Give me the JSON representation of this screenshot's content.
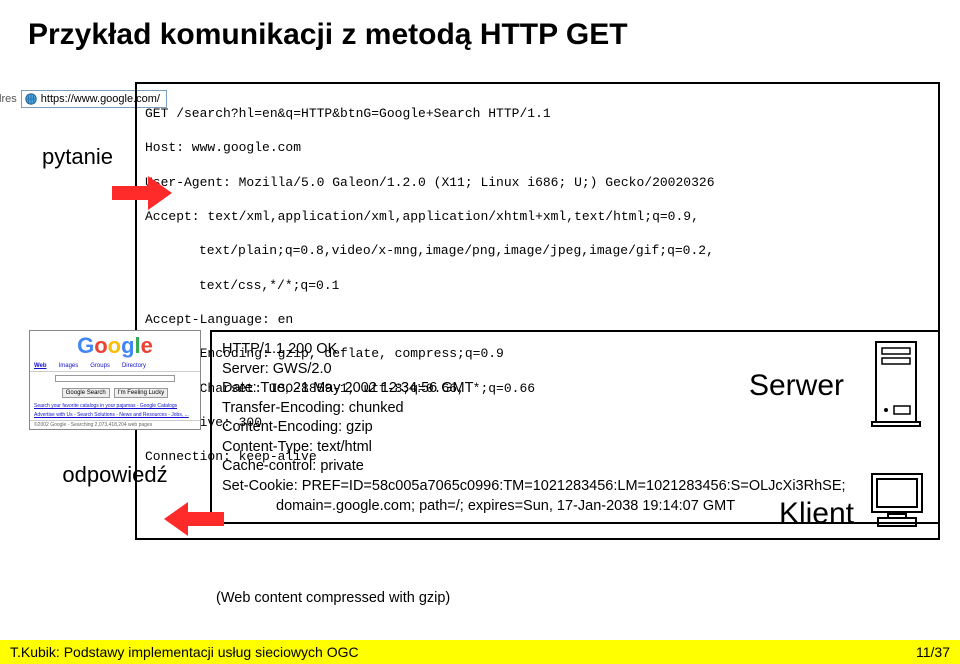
{
  "title": "Przykład komunikacji z metodą HTTP GET",
  "address": {
    "label": "Adres",
    "url": "https://www.google.com/"
  },
  "labels": {
    "pytanie": "pytanie",
    "odpowiedz": "odpowiedź",
    "klient": "Klient",
    "serwer": "Serwer"
  },
  "request": {
    "l1": "GET /search?hl=en&q=HTTP&btnG=Google+Search HTTP/1.1",
    "l2": "Host: www.google.com",
    "l3": "User-Agent: Mozilla/5.0 Galeon/1.2.0 (X11; Linux i686; U;) Gecko/20020326",
    "l4": "Accept: text/xml,application/xml,application/xhtml+xml,text/html;q=0.9,",
    "l5": "text/plain;q=0.8,video/x-mng,image/png,image/jpeg,image/gif;q=0.2,",
    "l6": "text/css,*/*;q=0.1",
    "l7": "Accept-Language: en",
    "l8": "Accept-Encoding: gzip, deflate, compress;q=0.9",
    "l9": "Accept-Charset: ISO-8859-1, utf-8;q=0.66, *;q=0.66",
    "l10": "Keep-Alive: 300",
    "l11": "Connection: keep-alive"
  },
  "google_shot": {
    "tabs": [
      "Web",
      "Images",
      "Groups",
      "Directory"
    ],
    "btn1": "Google Search",
    "btn2": "I'm Feeling Lucky",
    "link1": "Search your favorite catalogs in your pajamas - Google Catalogs",
    "link2": "Advertise with Us - Search Solutions - News and Resources - Jobs, ...",
    "foot": "©2002 Google - Searching 2,073,418,204 web pages"
  },
  "response": {
    "l1": "HTTP/1.1 200 OK",
    "l2": "Server: GWS/2.0",
    "l3": "Date: Tue, 21 May 2002 12:34:56 GMT",
    "l4": "Transfer-Encoding: chunked",
    "l5": "Content-Encoding: gzip",
    "l6": "Content-Type: text/html",
    "l7": "Cache-control: private",
    "l8": "Set-Cookie: PREF=ID=58c005a7065c0996:TM=1021283456:LM=1021283456:S=OLJcXi3RhSE;",
    "l9": "domain=.google.com; path=/; expires=Sun, 17-Jan-2038 19:14:07 GMT"
  },
  "web_note": "(Web content compressed with gzip)",
  "footer": {
    "left": "T.Kubik: Podstawy implementacji usług sieciowych OGC",
    "right": "11/37"
  }
}
